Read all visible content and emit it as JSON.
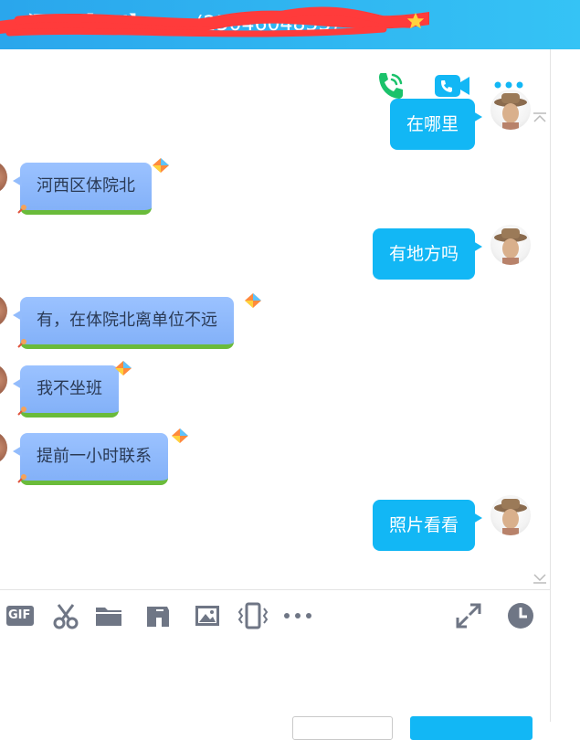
{
  "window": {
    "title": "河西 【MM】 ……(2504604853)",
    "accent_color": "#12b7f5",
    "titlebar_color": "#2aa6ec"
  },
  "header_actions": {
    "voice_call_icon": "phone-icon",
    "video_call_icon": "video-camera-icon",
    "more_icon": "more-dots-icon"
  },
  "messages": [
    {
      "dir": "out",
      "text": "在哪里"
    },
    {
      "dir": "in",
      "text": "河西区体院北"
    },
    {
      "dir": "out",
      "text": "有地方吗"
    },
    {
      "dir": "in",
      "text": "有，在体院北离单位不远"
    },
    {
      "dir": "in",
      "text": "我不坐班"
    },
    {
      "dir": "in",
      "text": "提前一小时联系"
    },
    {
      "dir": "out",
      "text": "照片看看"
    }
  ],
  "input_toolbar": {
    "gif_label": "GIF",
    "icons": [
      "gif-icon",
      "scissors-icon",
      "folder-icon",
      "music-note-icon",
      "image-icon",
      "vibrate-icon",
      "more-dots-icon",
      "expand-icon",
      "history-clock-icon"
    ]
  },
  "colors": {
    "outgoing_bubble": "#12b7f5",
    "incoming_bubble": "#8fb9fb",
    "incoming_border": "#6abb3a"
  }
}
